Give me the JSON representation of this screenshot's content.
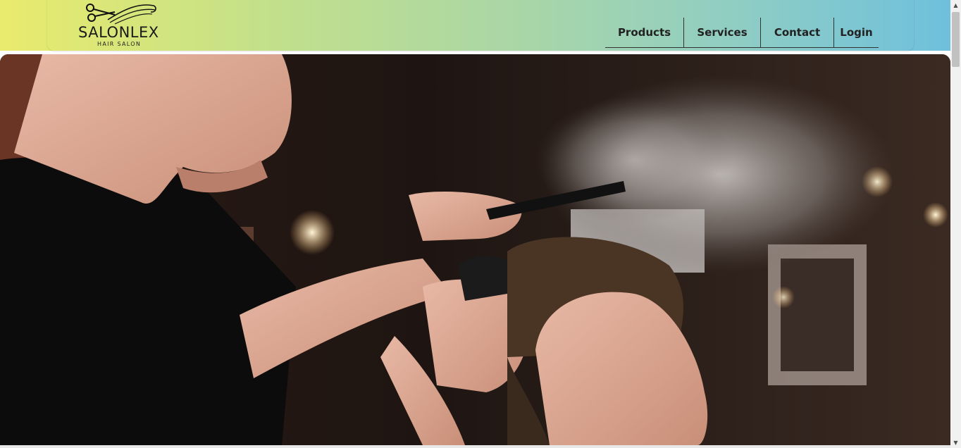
{
  "brand": {
    "name": "SALONLEX",
    "tagline": "HAIR SALON"
  },
  "nav": [
    {
      "id": "products",
      "label": "Products"
    },
    {
      "id": "services",
      "label": "Services"
    },
    {
      "id": "contact",
      "label": "Contact"
    },
    {
      "id": "login",
      "label": "Login"
    }
  ],
  "hero": {
    "image": "barber-spraying-client-hair-photo"
  },
  "icons": {
    "logo": "scissors-icon",
    "scroll_up": "arrow-up-icon",
    "scroll_down": "arrow-down-icon"
  },
  "colors": {
    "header_gradient_start": "#e9eb6c",
    "header_gradient_end": "#6ec0dd",
    "nav_text": "#222222"
  }
}
